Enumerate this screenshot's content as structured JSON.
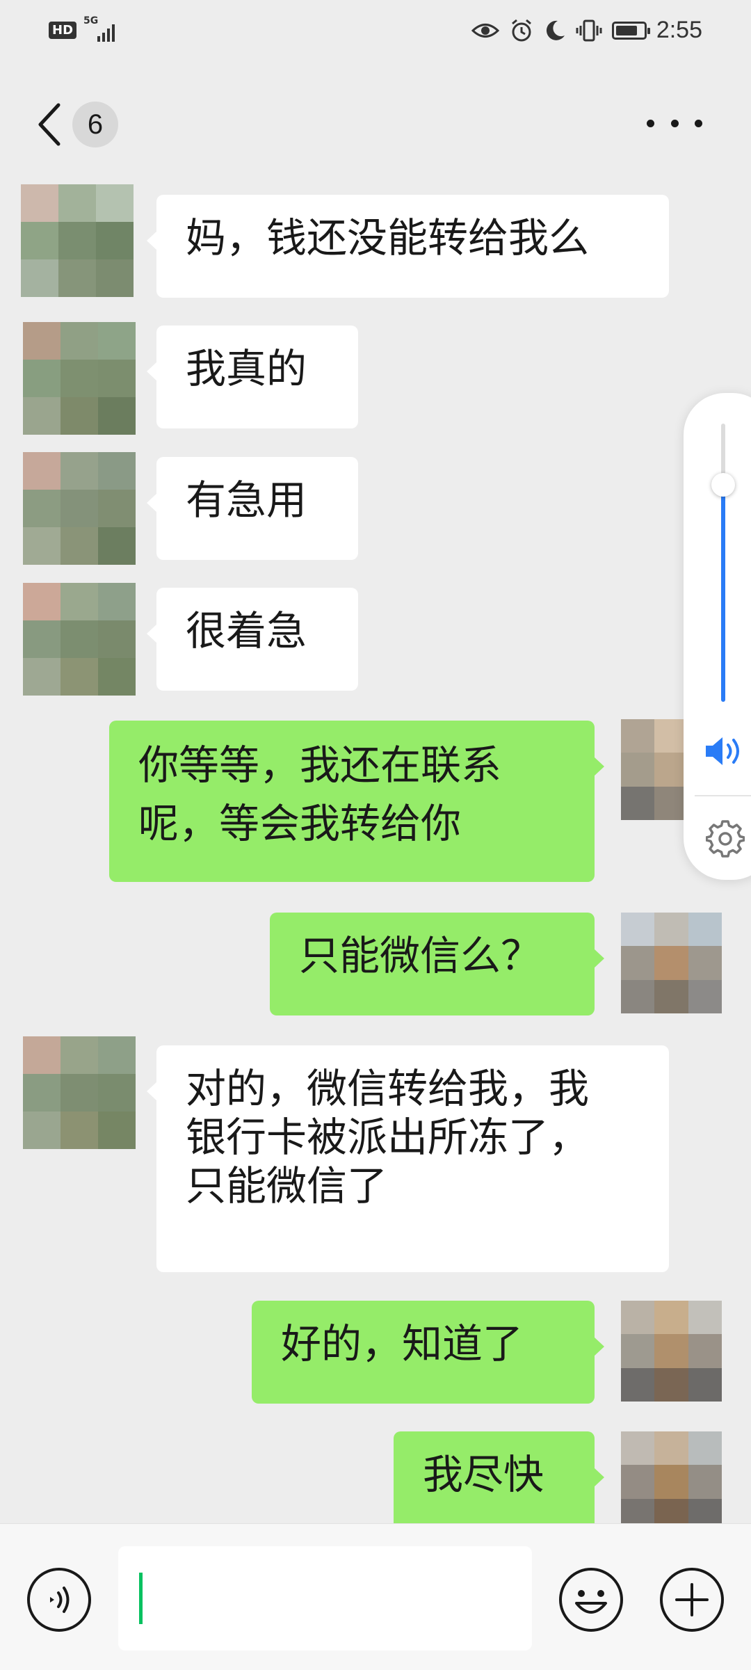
{
  "status_bar": {
    "hd": "HD",
    "network": "5G",
    "time": "2:55",
    "icons": [
      "eye-icon",
      "alarm-icon",
      "moon-icon",
      "vibrate-icon",
      "battery-icon"
    ]
  },
  "nav": {
    "unread_count": "6",
    "title": "",
    "icons": [
      "back-arrow-icon",
      "more-dots-icon"
    ]
  },
  "messages": [
    {
      "side": "in",
      "lines": [
        "妈，钱还没能转给我么"
      ]
    },
    {
      "side": "in",
      "lines": [
        "我真的"
      ]
    },
    {
      "side": "in",
      "lines": [
        "有急用"
      ]
    },
    {
      "side": "in",
      "lines": [
        "很着急"
      ]
    },
    {
      "side": "out",
      "lines": [
        "你等等，我还在联系",
        "呢，等会我转给你"
      ]
    },
    {
      "side": "out",
      "lines": [
        "只能微信么？"
      ]
    },
    {
      "side": "in",
      "lines": [
        "对的，微信转给我，我",
        "银行卡被派出所冻了，",
        "只能微信了"
      ]
    },
    {
      "side": "out",
      "lines": [
        "好的，知道了"
      ]
    },
    {
      "side": "out",
      "lines": [
        "我尽快"
      ]
    }
  ],
  "volume": {
    "level": 0.78,
    "accent": "#2a7cf6",
    "icons": [
      "speaker-icon",
      "settings-gear-icon"
    ]
  },
  "input": {
    "value": "",
    "icons": [
      "voice-input-icon",
      "emoji-icon",
      "plus-icon"
    ]
  },
  "colors": {
    "background": "#ededed",
    "incoming_bubble": "#ffffff",
    "outgoing_bubble": "#95ec69",
    "cursor": "#07c160"
  }
}
